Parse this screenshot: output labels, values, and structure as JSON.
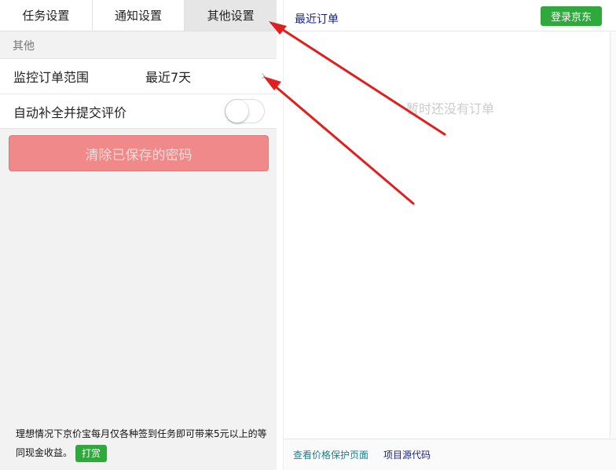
{
  "left": {
    "tabs": [
      {
        "label": "任务设置"
      },
      {
        "label": "通知设置"
      },
      {
        "label": "其他设置"
      }
    ],
    "section_label": "其他",
    "rows": [
      {
        "label": "监控订单范围",
        "value": "最近7天"
      },
      {
        "label": "自动补全并提交评价"
      }
    ],
    "clear_button": "清除已保存的密码",
    "footer": {
      "text": "理想情况下京价宝每月仅各种签到任务即可带来5元以上的等同现金收益。",
      "tip_button": "打赏"
    }
  },
  "right": {
    "title": "最近订单",
    "login_button": "登录京东",
    "empty_message": "暂时还没有订单",
    "footer_links": [
      {
        "label": "查看价格保护页面"
      },
      {
        "label": "项目源代码"
      }
    ]
  },
  "colors": {
    "accent_green": "#2fa83c",
    "danger_button": "#f08a8a",
    "annotation_arrow": "#e02020"
  }
}
